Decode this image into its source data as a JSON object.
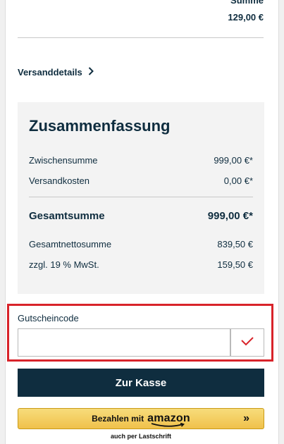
{
  "cart": {
    "sum_label": "Summe",
    "sum_value": "129,00 €"
  },
  "shipping": {
    "link_label": "Versanddetails",
    "icon": "chevron-right-icon"
  },
  "summary": {
    "title": "Zusammenfassung",
    "subtotal_label": "Zwischensumme",
    "subtotal_value": "999,00 €*",
    "shipping_label": "Versandkosten",
    "shipping_value": "0,00 €*",
    "total_label": "Gesamtsumme",
    "total_value": "999,00 €*",
    "net_label": "Gesamtnettosumme",
    "net_value": "839,50 €",
    "vat_label": "zzgl. 19 % MwSt.",
    "vat_value": "159,50 €"
  },
  "coupon": {
    "label": "Gutscheincode",
    "value": "",
    "placeholder": "",
    "submit_icon": "checkmark-icon"
  },
  "checkout": {
    "button_label": "Zur Kasse"
  },
  "amazon_pay": {
    "prefix": "Bezahlen mit",
    "brand": "amazon",
    "arrows": "»",
    "subtext": "auch per Lastschrift"
  },
  "colors": {
    "primary": "#0f2d3f",
    "highlight": "#d8232a",
    "amazon_button": "#f0c14b",
    "summary_background": "#f3f3f3"
  }
}
